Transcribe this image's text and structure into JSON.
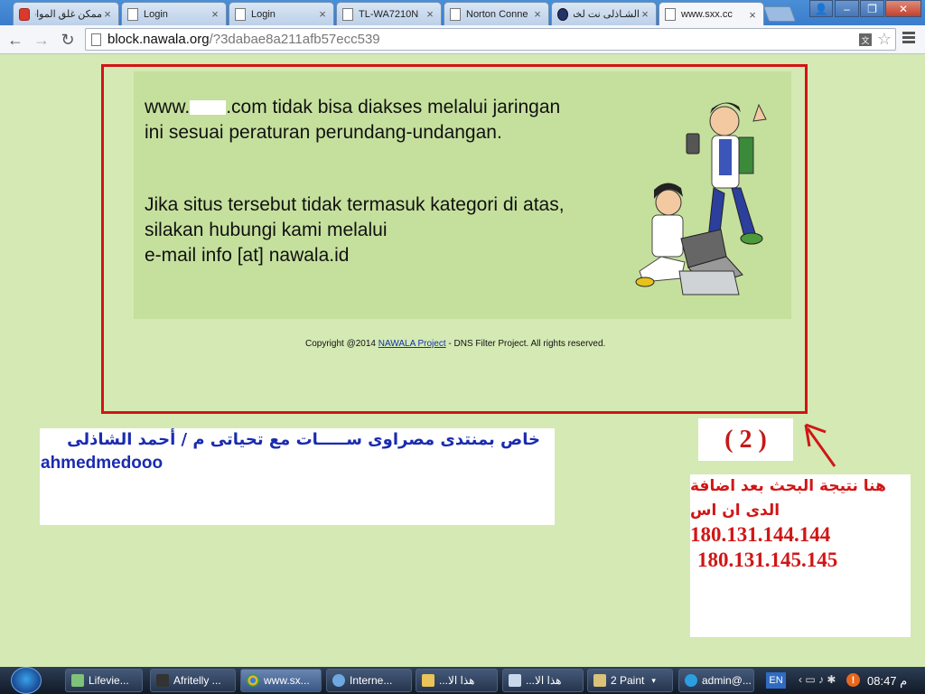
{
  "tabs": [
    {
      "label": "ممكن غلق المواقع",
      "icon": "red-logo-icon",
      "active": false
    },
    {
      "label": "Login",
      "icon": "page-icon",
      "active": false
    },
    {
      "label": "Login",
      "icon": "page-icon",
      "active": false
    },
    {
      "label": "TL-WA7210N",
      "icon": "page-icon",
      "active": false
    },
    {
      "label": "Norton Conne",
      "icon": "page-icon",
      "active": false
    },
    {
      "label": "الشـاذلى نت لخدمة",
      "icon": "nawala-n-icon",
      "active": false
    },
    {
      "label": "www.sxx.cc",
      "icon": "page-icon",
      "active": true
    }
  ],
  "tab_close_glyph": "×",
  "toolbar": {
    "url_host": "block.nawala.org",
    "url_path": "/?3dabae8a211afb57ecc539",
    "back_glyph": "←",
    "forward_glyph": "→",
    "reload_glyph": "↻",
    "star_glyph": "☆"
  },
  "block_page": {
    "msg1_prefix": "www.",
    "msg1_rest": ".com tidak bisa diakses melalui jaringan ini sesuai peraturan perundang-undangan.",
    "msg2_line1": "Jika situs tersebut tidak termasuk kategori di atas, silakan hubungi kami melalui",
    "msg2_line2": "e-mail info [at] nawala.id",
    "copyright_prefix": "Copyright @2014 ",
    "copyright_link": "NAWALA Project",
    "copyright_suffix": " - DNS Filter Project. All rights reserved."
  },
  "annotations": {
    "left_arabic": "خاص بمنتدى مصراوى ســـــات مع تحياتى م / أحمد الشاذلى",
    "left_latin": "ahmedmedooo",
    "step": "( 2 )",
    "right_line1": "هنا نتيجة البحث بعد اضافة",
    "right_line2": "الدى ان اس",
    "ip1": "180.131.144.144",
    "ip2": "180.131.145.145"
  },
  "taskbar": {
    "items": [
      {
        "label": "Lifevie...",
        "active": false
      },
      {
        "label": "Afritelly ...",
        "active": false
      },
      {
        "label": "www.sx...",
        "active": true
      },
      {
        "label": "Interne...",
        "active": false
      },
      {
        "label": "هذا الا...",
        "active": false
      },
      {
        "label": "هذا الا...",
        "active": false
      },
      {
        "label": "2 Paint",
        "active": false
      },
      {
        "label": "admin@...",
        "active": false
      }
    ],
    "lang": "EN",
    "clock": "08:47 م"
  },
  "colors": {
    "page_bg": "#d4e9b4",
    "inner_bg": "#c5e09d",
    "block_border": "#d21414",
    "annotation_blue": "#1a2bb0",
    "annotation_red": "#d11616"
  }
}
